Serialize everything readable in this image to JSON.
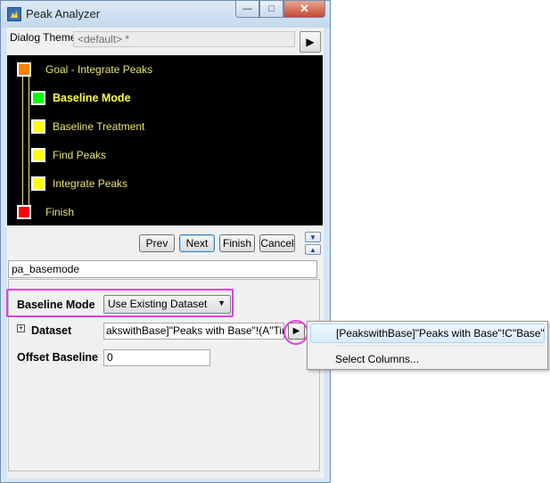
{
  "window": {
    "title": "Peak Analyzer",
    "min_glyph": "—",
    "max_glyph": "□",
    "close_glyph": "✕"
  },
  "theme": {
    "label": "Dialog Theme",
    "value": "<default> *",
    "button_glyph": "▶"
  },
  "tree": {
    "nodes": [
      {
        "label": "Goal - Integrate Peaks",
        "color": "#ff8000"
      },
      {
        "label": "Baseline Mode",
        "color": "#00ff00",
        "current": true
      },
      {
        "label": "Baseline Treatment",
        "color": "#ffff00"
      },
      {
        "label": "Find Peaks",
        "color": "#ffff00"
      },
      {
        "label": "Integrate Peaks",
        "color": "#ffff00"
      },
      {
        "label": "Finish",
        "color": "#ff0000"
      }
    ]
  },
  "nav": {
    "prev": "Prev",
    "next": "Next",
    "finish": "Finish",
    "cancel": "Cancel",
    "up_glyph": "▲",
    "down_glyph": "▼"
  },
  "page_name": "pa_basemode",
  "baseline_mode": {
    "label": "Baseline Mode",
    "value": "Use Existing Dataset",
    "arrow": "▼"
  },
  "dataset": {
    "expander": "+",
    "label": "Dataset",
    "value": "akswithBase]\"Peaks with Base\"!(A\"Time\"",
    "button_glyph": "▶"
  },
  "offset_baseline": {
    "label": "Offset Baseline",
    "value": "0"
  },
  "context_menu": {
    "items": [
      "[PeakswithBase]\"Peaks with Base\"!C\"Base\"",
      "Select Columns..."
    ]
  },
  "colors": {
    "highlight": "#e53fe5",
    "tree_background": "#000000",
    "tree_text": "#e8e36e"
  }
}
